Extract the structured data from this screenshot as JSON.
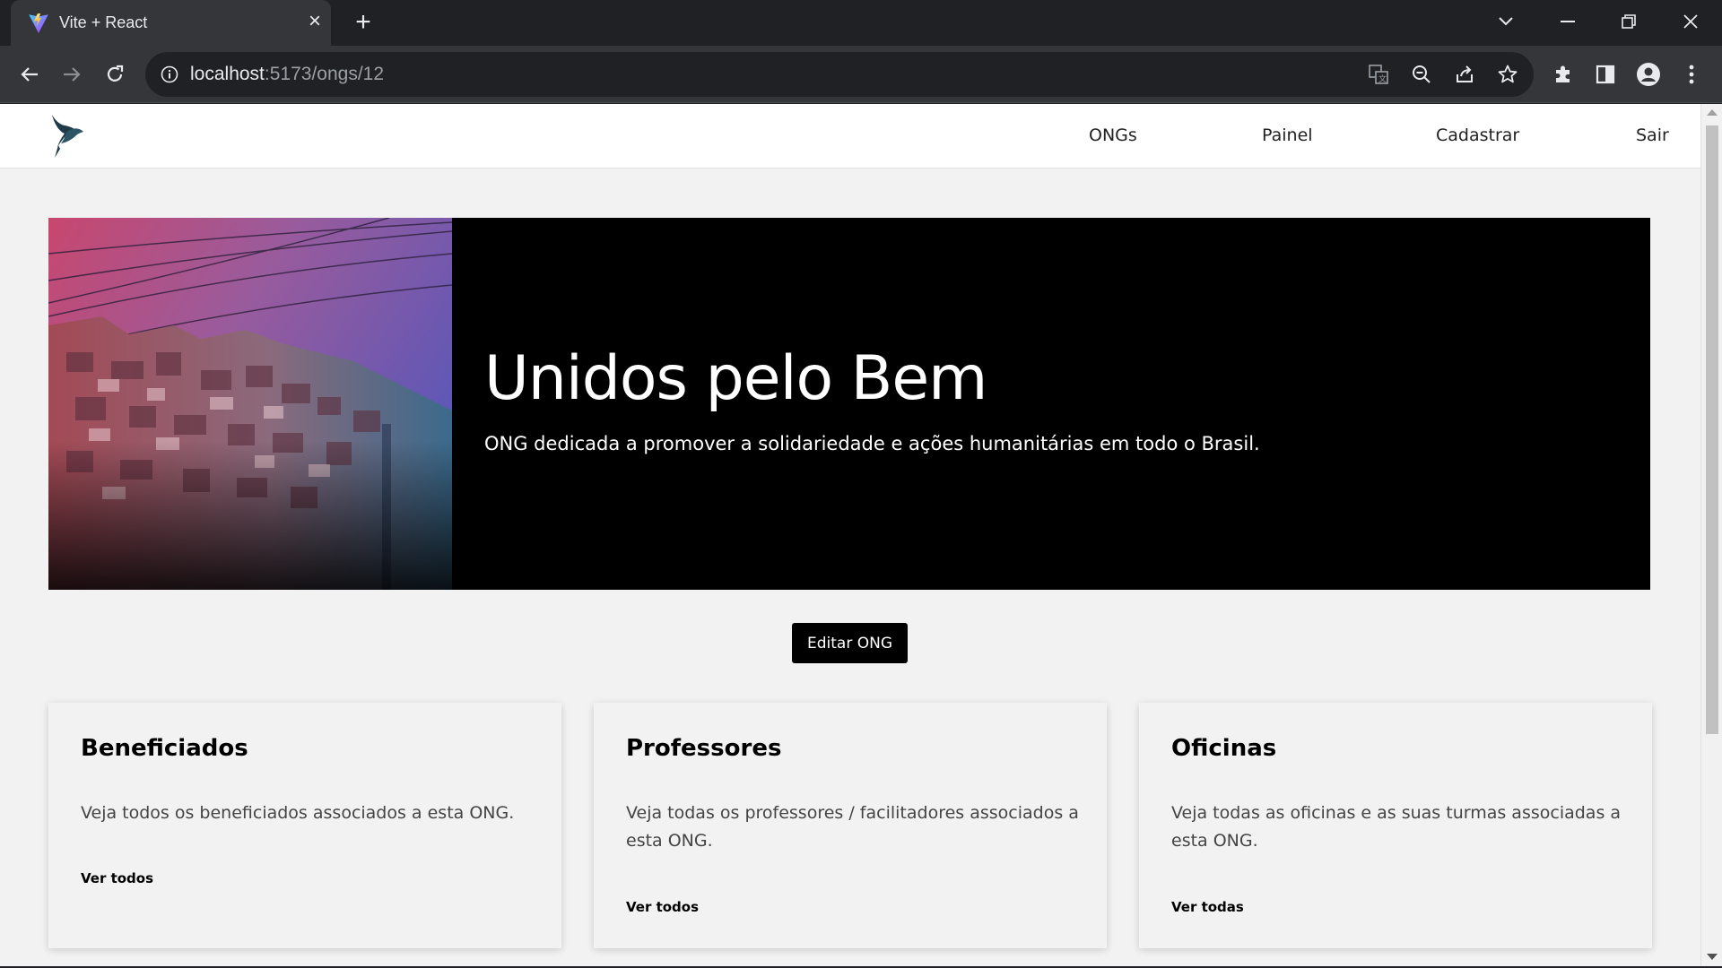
{
  "browser": {
    "tab_title": "Vite + React",
    "url_host": "localhost",
    "url_path": ":5173/ongs/12"
  },
  "nav": {
    "items": [
      "ONGs",
      "Painel",
      "Cadastrar",
      "Sair"
    ]
  },
  "hero": {
    "title": "Unidos pelo Bem",
    "subtitle": "ONG dedicada a promover a solidariedade e ações humanitárias em todo o Brasil."
  },
  "edit_button": "Editar ONG",
  "cards": [
    {
      "title": "Beneficiados",
      "text": "Veja todos os beneficiados associados a esta ONG.",
      "link": "Ver todos"
    },
    {
      "title": "Professores",
      "text": "Veja todas os professores / facilitadores associados a esta ONG.",
      "link": "Ver todos"
    },
    {
      "title": "Oficinas",
      "text": "Veja todas as oficinas e as suas turmas associadas a esta ONG.",
      "link": "Ver todas"
    }
  ],
  "colors": {
    "chrome_dark": "#202124",
    "chrome_toolbar": "#35363a",
    "page_bg": "#f2f2f2",
    "hero_bg": "#000000",
    "button_bg": "#000000"
  }
}
